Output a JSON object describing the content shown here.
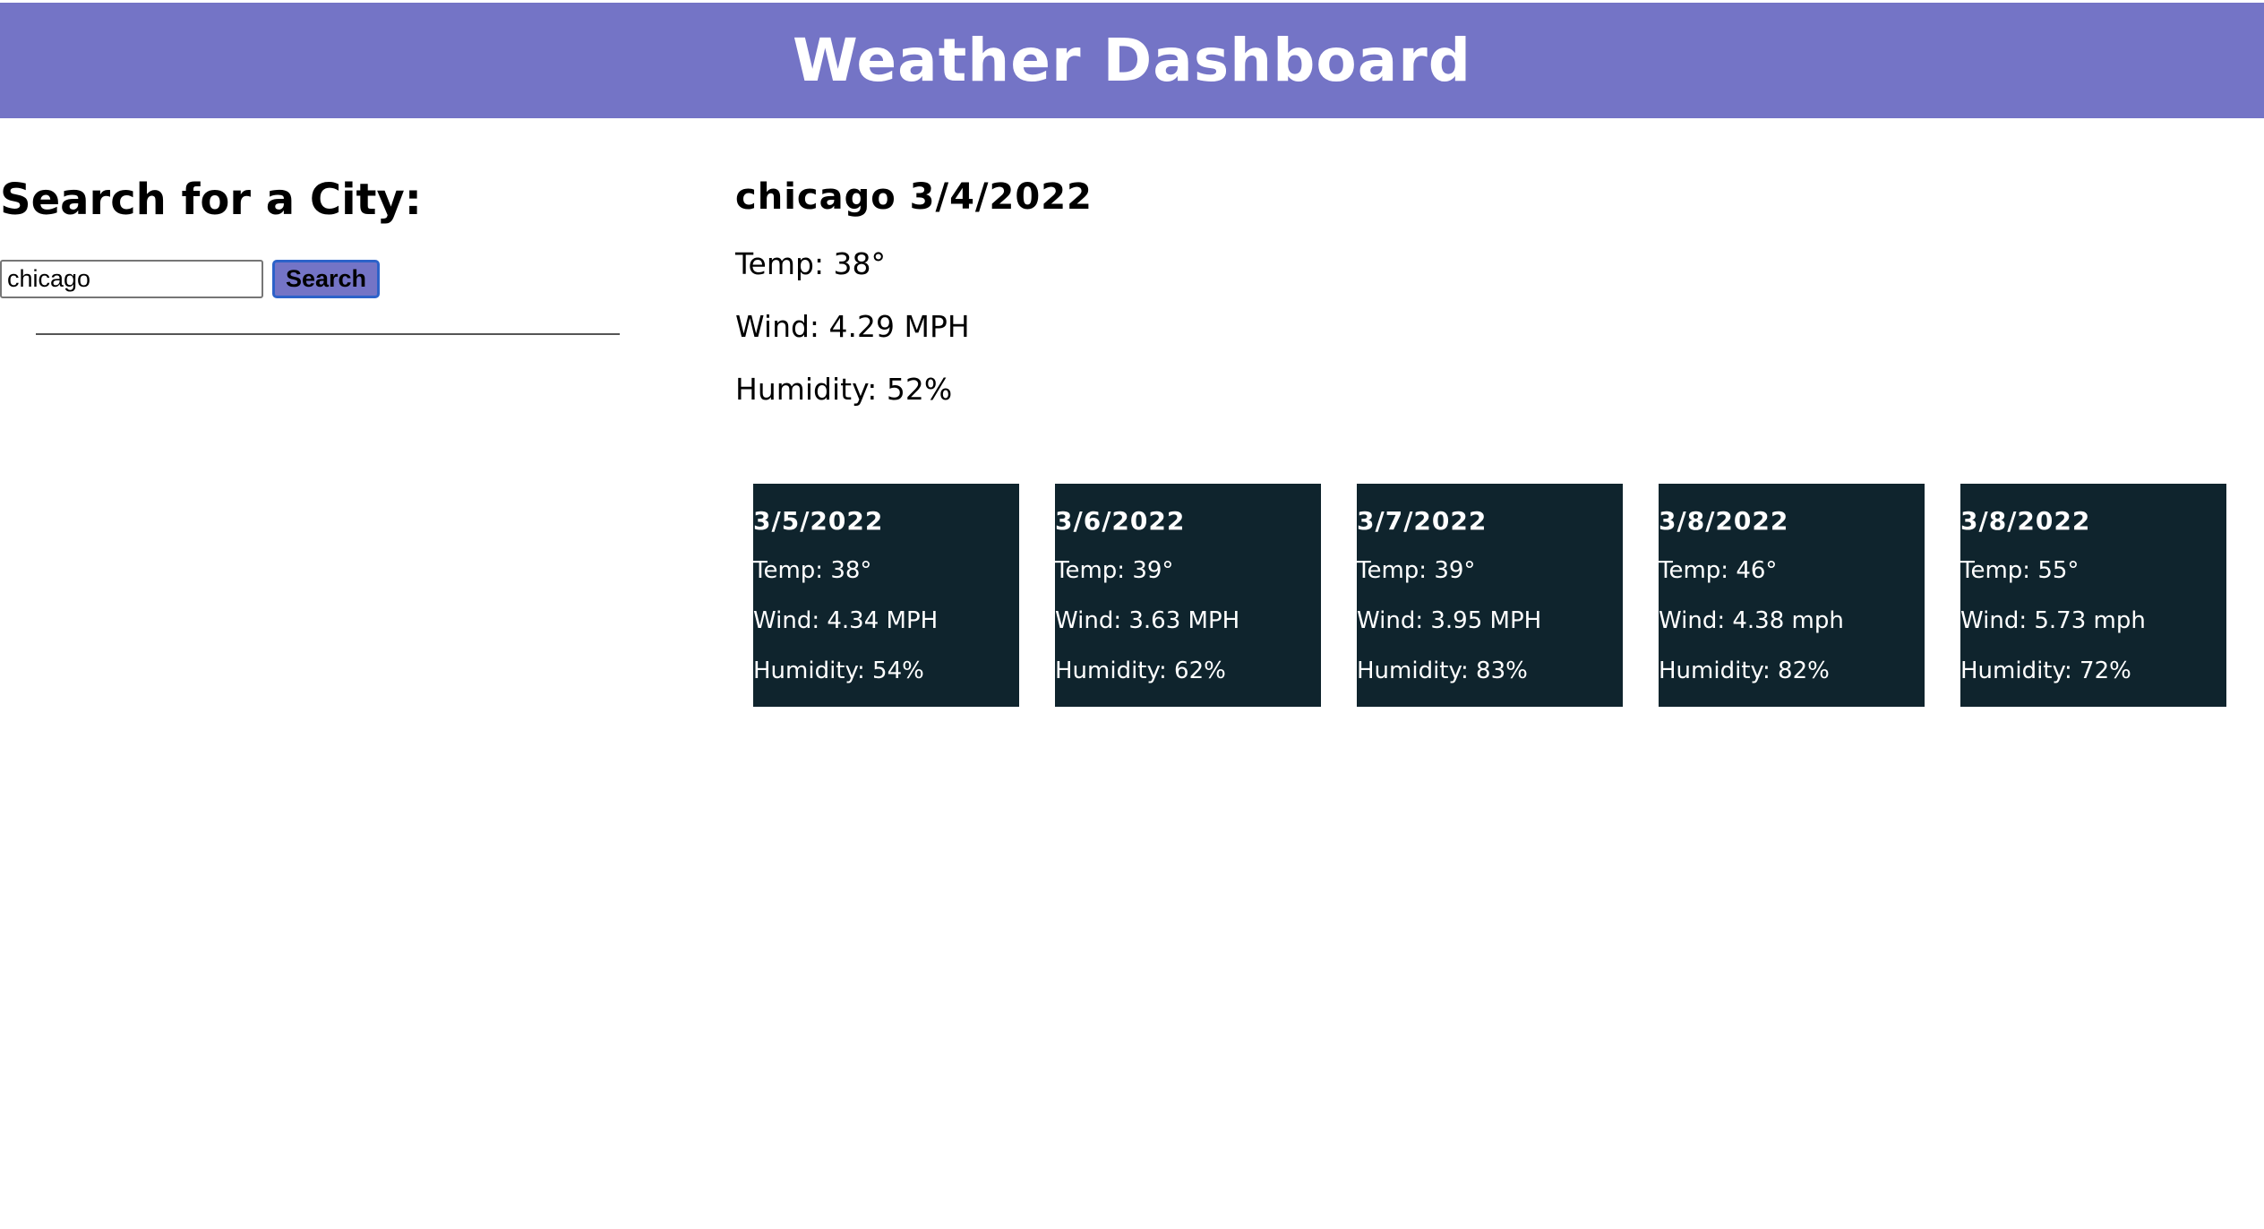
{
  "header": {
    "title": "Weather Dashboard"
  },
  "search": {
    "title": "Search for a City:",
    "input_value": "chicago",
    "button_label": "Search"
  },
  "current": {
    "title": "chicago 3/4/2022",
    "temp": "Temp: 38°",
    "wind": "Wind: 4.29 MPH",
    "humidity": "Humidity: 52%"
  },
  "forecast": [
    {
      "date": "3/5/2022",
      "temp": "Temp: 38°",
      "wind": "Wind: 4.34 MPH",
      "humidity": "Humidity: 54%"
    },
    {
      "date": "3/6/2022",
      "temp": "Temp: 39°",
      "wind": "Wind: 3.63 MPH",
      "humidity": "Humidity: 62%"
    },
    {
      "date": "3/7/2022",
      "temp": "Temp: 39°",
      "wind": "Wind: 3.95 MPH",
      "humidity": "Humidity: 83%"
    },
    {
      "date": "3/8/2022",
      "temp": "Temp: 46°",
      "wind": "Wind: 4.38 mph",
      "humidity": "Humidity: 82%"
    },
    {
      "date": "3/8/2022",
      "temp": "Temp: 55°",
      "wind": "Wind: 5.73 mph",
      "humidity": "Humidity: 72%"
    }
  ],
  "colors": {
    "header_bg": "#7474c6",
    "card_bg": "#0f242d",
    "button_border": "#2d62c9"
  }
}
